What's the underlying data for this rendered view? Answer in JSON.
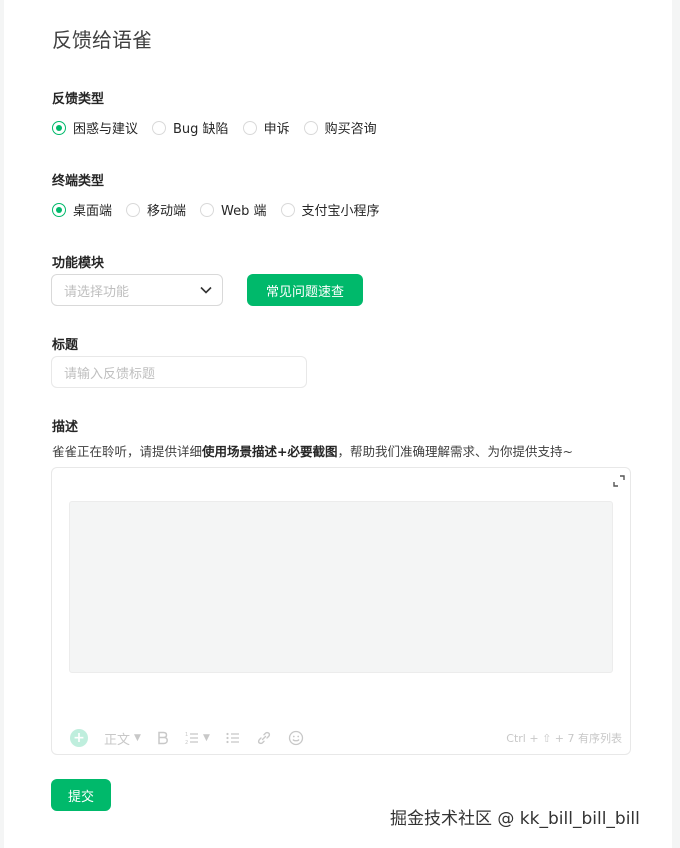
{
  "page": {
    "title": "反馈给语雀"
  },
  "feedback_type": {
    "label": "反馈类型",
    "options": [
      "困惑与建议",
      "Bug 缺陷",
      "申诉",
      "购买咨询"
    ],
    "selected": 0
  },
  "terminal_type": {
    "label": "终端类型",
    "options": [
      "桌面端",
      "移动端",
      "Web 端",
      "支付宝小程序"
    ],
    "selected": 0
  },
  "module": {
    "label": "功能模块",
    "select_placeholder": "请选择功能",
    "faq_button": "常见问题速查"
  },
  "subject": {
    "label": "标题",
    "placeholder": "请输入反馈标题"
  },
  "description": {
    "label": "描述",
    "hint_prefix": "雀雀正在聆听，请提供详细",
    "hint_bold": "使用场景描述+必要截图",
    "hint_suffix": "，帮助我们准确理解需求、为你提供支持~"
  },
  "editor_toolbar": {
    "paragraph_style": "正文",
    "shortcut_hint": "Ctrl + ⇧ + 7  有序列表"
  },
  "submit_label": "提交",
  "watermark": "掘金技术社区 @ kk_bill_bill_bill",
  "colors": {
    "accent": "#00b96b",
    "border": "#d9d9d9"
  }
}
